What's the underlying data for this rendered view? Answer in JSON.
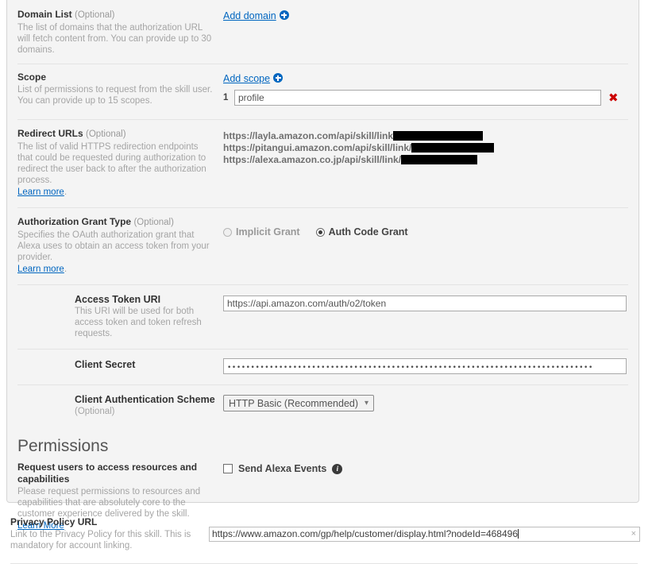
{
  "account_linking": {
    "domain_list": {
      "title": "Domain List",
      "optional": "(Optional)",
      "description": "The list of domains that the authorization URL will fetch content from. You can provide up to 30 domains.",
      "add_link": "Add domain",
      "add_icon": "plus-circle-icon"
    },
    "scope": {
      "title": "Scope",
      "description": "List of permissions to request from the skill user. You can provide up to 15 scopes.",
      "add_link": "Add scope",
      "add_icon": "plus-circle-icon",
      "items": [
        {
          "number": "1",
          "value": "profile",
          "delete_icon": "✖"
        }
      ]
    },
    "redirect_urls": {
      "title": "Redirect URLs",
      "optional": "(Optional)",
      "description": "The list of valid HTTPS redirection endpoints that could be requested during authorization to redirect the user back to after the authorization process.",
      "learn_more": "Learn more",
      "learn_more_suffix": ".",
      "urls": [
        {
          "text": "https://layla.amazon.com/api/skill/link",
          "redacted_width": 113
        },
        {
          "text": "https://pitangui.amazon.com/api/skill/link/",
          "redacted_width": 104
        },
        {
          "text": "https://alexa.amazon.co.jp/api/skill/link/",
          "redacted_width": 96
        }
      ]
    },
    "grant_type": {
      "title": "Authorization Grant Type",
      "optional": "(Optional)",
      "description": "Specifies the OAuth authorization grant that Alexa uses to obtain an access token from your provider.",
      "learn_more": "Learn more",
      "learn_more_suffix": ".",
      "options": [
        {
          "label": "Implicit Grant",
          "selected": false
        },
        {
          "label": "Auth Code Grant",
          "selected": true
        }
      ]
    },
    "access_token_uri": {
      "title": "Access Token URI",
      "description": "This URI will be used for both access token and token refresh requests.",
      "value": "https://api.amazon.com/auth/o2/token"
    },
    "client_secret": {
      "title": "Client Secret",
      "masked_value": "••••••••••••••••••••••••••••••••••••••••••••••••••••••••••••••••••••••••••••••"
    },
    "client_auth_scheme": {
      "title": "Client Authentication Scheme",
      "optional": "(Optional)",
      "selected": "HTTP Basic (Recommended)",
      "chevron_icon": "chevron-down-icon"
    }
  },
  "permissions": {
    "heading": "Permissions",
    "title": "Request users to access resources and capabilities",
    "description": "Please request permissions to resources and capabilities that are absolutely core to the customer experience delivered by the skill.",
    "learn_more": "Learn More",
    "checkbox": {
      "label": "Send Alexa Events",
      "checked": false,
      "info_icon": "i"
    }
  },
  "privacy_policy": {
    "title": "Privacy Policy URL",
    "description": "Link to the Privacy Policy for this skill. This is mandatory for account linking.",
    "value": "https://www.amazon.com/gp/help/customer/display.html?nodeId=468496",
    "clear_icon": "×"
  },
  "colors": {
    "link": "#0066c0",
    "delete": "#cc0000",
    "panel_bg": "#f4f4f4",
    "muted_text": "#a5a5a5"
  }
}
